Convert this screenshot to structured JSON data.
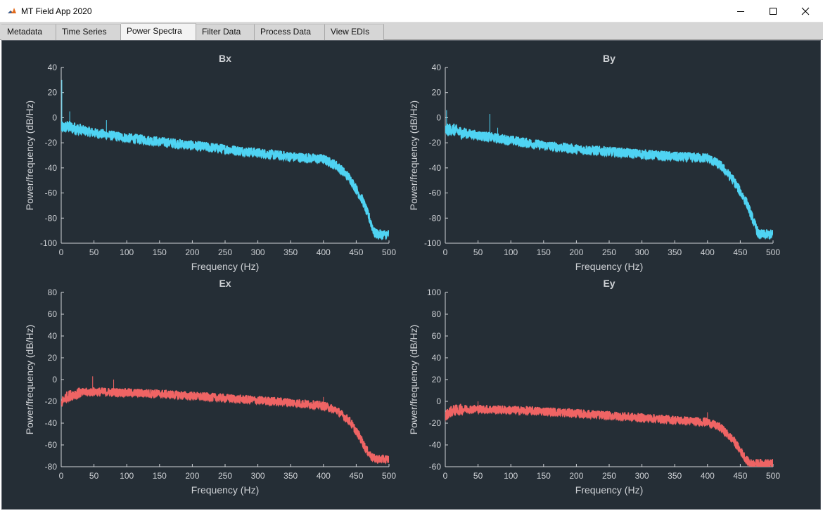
{
  "window": {
    "title": "MT Field App 2020"
  },
  "tabs": [
    {
      "label": "Metadata",
      "active": false
    },
    {
      "label": "Time Series",
      "active": false
    },
    {
      "label": "Power Spectra",
      "active": true
    },
    {
      "label": "Filter Data",
      "active": false
    },
    {
      "label": "Process Data",
      "active": false
    },
    {
      "label": "View EDIs",
      "active": false
    }
  ],
  "colors": {
    "panel_background": "#252e36",
    "axis_text": "#cfd2d6",
    "magnetic_series": "#4fd3f2",
    "electric_series": "#ef6464"
  },
  "chart_data": [
    {
      "type": "line",
      "title": "Bx",
      "xlabel": "Frequency (Hz)",
      "ylabel": "Power/frequency (dB/Hz)",
      "xlim": [
        0,
        500
      ],
      "ylim": [
        -100,
        40
      ],
      "xticks": [
        "0",
        "50",
        "100",
        "150",
        "200",
        "250",
        "300",
        "350",
        "400",
        "450",
        "500"
      ],
      "yticks": [
        "40",
        "20",
        "0",
        "-20",
        "-40",
        "-60",
        "-80",
        "-100"
      ],
      "grid": false,
      "color": "#4fd3f2",
      "x": [
        0,
        10,
        25,
        50,
        100,
        150,
        200,
        250,
        300,
        350,
        400,
        420,
        440,
        460,
        470,
        478,
        485,
        500
      ],
      "y": [
        -8,
        -7,
        -9,
        -12,
        -16,
        -19,
        -22,
        -25,
        -28,
        -31,
        -33,
        -38,
        -48,
        -66,
        -80,
        -92,
        -93,
        -93
      ],
      "spikes": [
        [
          1,
          30
        ],
        [
          13,
          5
        ],
        [
          69,
          -2
        ]
      ]
    },
    {
      "type": "line",
      "title": "By",
      "xlabel": "Frequency (Hz)",
      "ylabel": "Power/frequency (dB/Hz)",
      "xlim": [
        0,
        500
      ],
      "ylim": [
        -100,
        40
      ],
      "xticks": [
        "0",
        "50",
        "100",
        "150",
        "200",
        "250",
        "300",
        "350",
        "400",
        "450",
        "500"
      ],
      "yticks": [
        "40",
        "20",
        "0",
        "-20",
        "-40",
        "-60",
        "-80",
        "-100"
      ],
      "grid": false,
      "color": "#4fd3f2",
      "x": [
        0,
        10,
        25,
        50,
        100,
        150,
        200,
        250,
        300,
        350,
        400,
        420,
        440,
        460,
        470,
        478,
        485,
        500
      ],
      "y": [
        -10,
        -9,
        -12,
        -14,
        -18,
        -22,
        -25,
        -27,
        -29,
        -31,
        -32,
        -38,
        -50,
        -68,
        -82,
        -93,
        -93,
        -93
      ],
      "spikes": [
        [
          2,
          6
        ],
        [
          68,
          3
        ],
        [
          80,
          -8
        ]
      ]
    },
    {
      "type": "line",
      "title": "Ex",
      "xlabel": "Frequency (Hz)",
      "ylabel": "Power/frequency (dB/Hz)",
      "xlim": [
        0,
        500
      ],
      "ylim": [
        -80,
        80
      ],
      "xticks": [
        "0",
        "50",
        "100",
        "150",
        "200",
        "250",
        "300",
        "350",
        "400",
        "450",
        "500"
      ],
      "yticks": [
        "80",
        "60",
        "40",
        "20",
        "0",
        "-20",
        "-40",
        "-60",
        "-80"
      ],
      "grid": false,
      "color": "#ef6464",
      "x": [
        0,
        5,
        15,
        30,
        50,
        100,
        150,
        200,
        250,
        300,
        350,
        400,
        420,
        440,
        455,
        465,
        475,
        485,
        500
      ],
      "y": [
        -22,
        -17,
        -14,
        -12,
        -11,
        -12,
        -13,
        -15,
        -17,
        -19,
        -21,
        -24,
        -28,
        -38,
        -52,
        -64,
        -72,
        -73,
        -73
      ],
      "spikes": [
        [
          48,
          3
        ],
        [
          80,
          0
        ],
        [
          400,
          -16
        ]
      ]
    },
    {
      "type": "line",
      "title": "Ey",
      "xlabel": "Frequency (Hz)",
      "ylabel": "Power/frequency (dB/Hz)",
      "xlim": [
        0,
        500
      ],
      "ylim": [
        -60,
        100
      ],
      "xticks": [
        "0",
        "50",
        "100",
        "150",
        "200",
        "250",
        "300",
        "350",
        "400",
        "450",
        "500"
      ],
      "yticks": [
        "100",
        "80",
        "60",
        "40",
        "20",
        "0",
        "-20",
        "-40",
        "-60"
      ],
      "grid": false,
      "color": "#ef6464",
      "x": [
        0,
        5,
        15,
        30,
        50,
        100,
        150,
        200,
        250,
        300,
        350,
        400,
        420,
        440,
        450,
        460,
        465,
        480,
        500
      ],
      "y": [
        -14,
        -10,
        -8,
        -7,
        -7,
        -8,
        -9,
        -11,
        -13,
        -15,
        -17,
        -19,
        -24,
        -36,
        -45,
        -54,
        -57,
        -57,
        -57
      ],
      "spikes": [
        [
          50,
          0
        ],
        [
          400,
          -10
        ]
      ]
    }
  ]
}
